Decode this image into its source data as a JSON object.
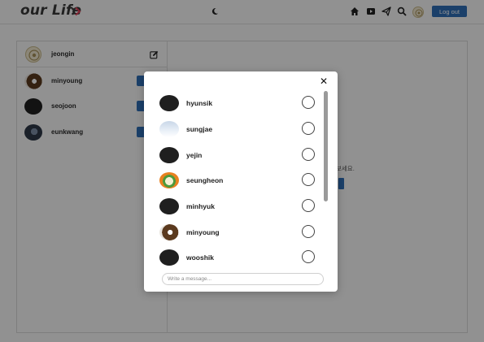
{
  "header": {
    "logo_text": "our Life",
    "logout_label": "Log out",
    "icons": [
      "moon-icon",
      "home-icon",
      "play-icon",
      "send-icon",
      "search-icon",
      "profile-avatar"
    ]
  },
  "sidebar": {
    "current_user": "jeongin",
    "contacts": [
      {
        "name": "minyoung",
        "avatar": "dog-photo"
      },
      {
        "name": "seojoon",
        "avatar": "dark"
      },
      {
        "name": "eunkwang",
        "avatar": "person-photo"
      }
    ]
  },
  "main": {
    "hint_text": "보세요."
  },
  "modal": {
    "users": [
      {
        "name": "hyunsik",
        "avatar": "dark"
      },
      {
        "name": "sungjae",
        "avatar": "person-photo"
      },
      {
        "name": "yejin",
        "avatar": "dark"
      },
      {
        "name": "seungheon",
        "avatar": "flower-photo"
      },
      {
        "name": "minhyuk",
        "avatar": "dark"
      },
      {
        "name": "minyoung",
        "avatar": "dog-photo"
      },
      {
        "name": "wooshik",
        "avatar": "dark"
      }
    ],
    "message_placeholder": "Write a message..."
  },
  "colors": {
    "accent": "#2f6fb7",
    "overlay": "rgba(0,0,0,0.42)"
  }
}
